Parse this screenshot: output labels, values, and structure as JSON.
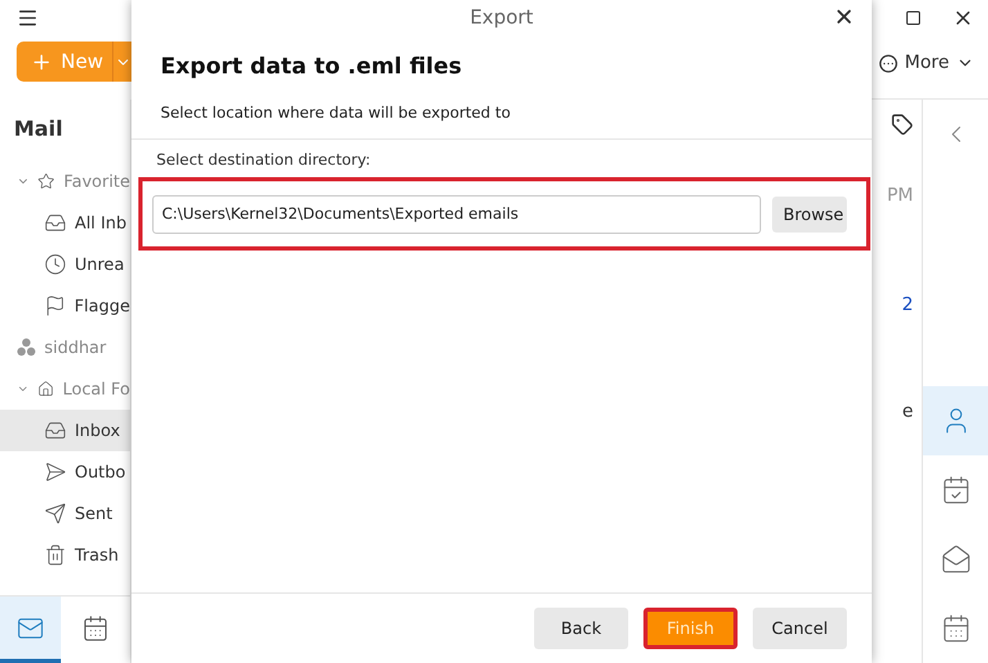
{
  "toolbar": {
    "new_button": "New",
    "more_button": "More"
  },
  "sidebar": {
    "title": "Mail",
    "items": [
      {
        "label": "Favorite",
        "kind": "star",
        "expanded": true,
        "selected": false,
        "children": [
          {
            "label": "All Inb",
            "kind": "inbox",
            "selected": false
          },
          {
            "label": "Unrea",
            "kind": "clock",
            "selected": false
          },
          {
            "label": "Flagge",
            "kind": "flag",
            "selected": false
          }
        ]
      },
      {
        "label": "siddhar",
        "kind": "account",
        "selected": false
      },
      {
        "label": "Local Fo",
        "kind": "home",
        "expanded": true,
        "selected": false,
        "children": [
          {
            "label": "Inbox",
            "kind": "inbox",
            "selected": true
          },
          {
            "label": "Outbo",
            "kind": "outbox",
            "selected": false
          },
          {
            "label": "Sent",
            "kind": "sent",
            "selected": false
          },
          {
            "label": "Trash",
            "kind": "trash",
            "selected": false
          }
        ]
      }
    ]
  },
  "bottom_nav": [
    {
      "kind": "mail",
      "selected": true
    },
    {
      "kind": "calendar",
      "selected": false
    }
  ],
  "message_pane": {
    "time": "PM",
    "link": "2",
    "text": "e"
  },
  "right_rail": [
    {
      "kind": "person",
      "selected": true
    },
    {
      "kind": "task",
      "selected": false
    },
    {
      "kind": "mail",
      "selected": false
    },
    {
      "kind": "calendar",
      "selected": false
    }
  ],
  "dialog": {
    "title": "Export",
    "heading": "Export data to .eml files",
    "subtitle": "Select location where data will be exported to",
    "field_label": "Select destination directory:",
    "path": "C:\\Users\\Kernel32\\Documents\\Exported emails",
    "browse_button": "Browse",
    "field_highlighted": true,
    "buttons": [
      {
        "label": "Back",
        "kind": "secondary",
        "highlighted": false
      },
      {
        "label": "Finish",
        "kind": "primary",
        "highlighted": true
      },
      {
        "label": "Cancel",
        "kind": "secondary",
        "highlighted": false
      }
    ]
  }
}
